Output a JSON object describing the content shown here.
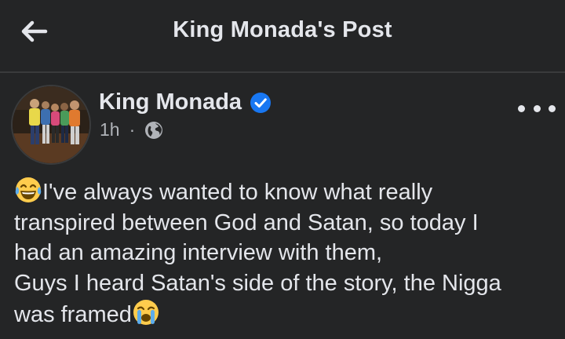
{
  "header": {
    "title": "King Monada's Post",
    "back_icon": "arrow-left-icon"
  },
  "post": {
    "author": "King Monada",
    "verified_icon": "verified-badge-icon",
    "time": "1h",
    "separator": "·",
    "audience_icon": "globe-icon",
    "more_icon": "more-options-icon",
    "lines": [
      "I've always wanted to know what really",
      "transpired between God and Satan, so today I",
      "had an amazing interview with them,",
      "Guys I heard Satan's side of the story, the Nigga",
      "was framed"
    ],
    "leading_emoji": "laughing-tears-emoji",
    "trailing_emoji": "crying-face-emoji"
  },
  "colors": {
    "background": "#242526",
    "text": "#e4e6eb",
    "muted": "#b0b3b8",
    "verified": "#1877f2"
  }
}
